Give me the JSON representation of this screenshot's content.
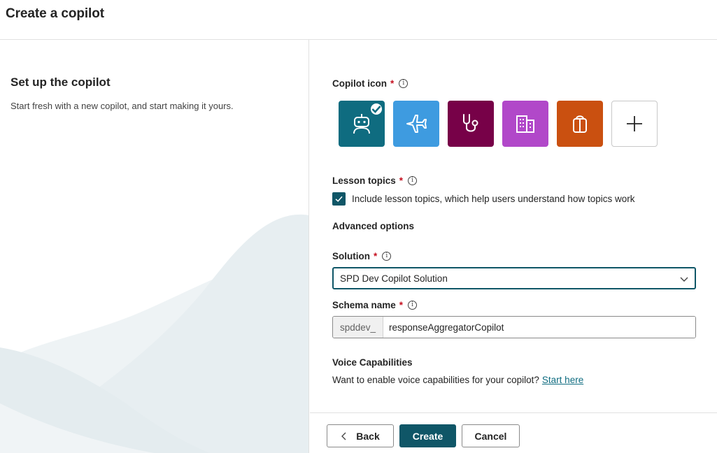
{
  "header": {
    "title": "Create a copilot"
  },
  "left": {
    "heading": "Set up the copilot",
    "description": "Start fresh with a new copilot, and start making it yours."
  },
  "copilot_icon": {
    "label": "Copilot icon",
    "required_mark": "*",
    "icons": [
      {
        "name": "robot-icon",
        "color": "#0f6c80",
        "selected": true
      },
      {
        "name": "airplane-icon",
        "color": "#3e9be0",
        "selected": false
      },
      {
        "name": "stethoscope-icon",
        "color": "#770148",
        "selected": false
      },
      {
        "name": "building-icon",
        "color": "#b148c9",
        "selected": false
      },
      {
        "name": "gift-icon",
        "color": "#ca5010",
        "selected": false
      },
      {
        "name": "add-icon",
        "color": "#ffffff",
        "selected": false
      }
    ]
  },
  "lesson_topics": {
    "label": "Lesson topics",
    "required_mark": "*",
    "checkbox_label": "Include lesson topics, which help users understand how topics work",
    "checked": true
  },
  "advanced": {
    "label": "Advanced options"
  },
  "solution": {
    "label": "Solution",
    "required_mark": "*",
    "selected": "SPD Dev Copilot Solution"
  },
  "schema": {
    "label": "Schema name",
    "required_mark": "*",
    "prefix": "spddev_",
    "value": "responseAggregatorCopilot"
  },
  "voice": {
    "label": "Voice Capabilities",
    "text": "Want to enable voice capabilities for your copilot?",
    "link": "Start here"
  },
  "footer": {
    "back": "Back",
    "create": "Create",
    "cancel": "Cancel"
  },
  "colors": {
    "accent": "#0f5667",
    "link": "#0f6c80",
    "required": "#c50f1f"
  }
}
